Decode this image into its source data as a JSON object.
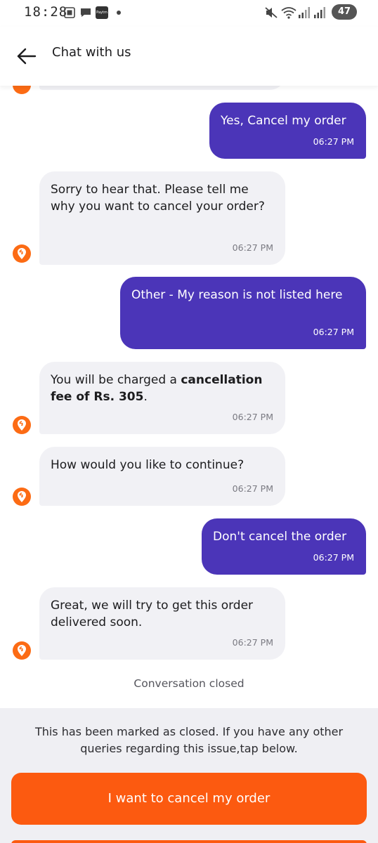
{
  "status_bar": {
    "time": "18:28",
    "paytm_label": "Paytm",
    "battery": "47"
  },
  "header": {
    "title": "Chat with us"
  },
  "messages": [
    {
      "from": "user",
      "text": "Yes, Cancel my order",
      "time": "06:27 PM"
    },
    {
      "from": "bot",
      "text": "Sorry to hear that. Please tell me why you want to cancel your order?",
      "time": "06:27 PM"
    },
    {
      "from": "user",
      "text": "Other - My reason is not listed here",
      "time": "06:27 PM"
    },
    {
      "from": "bot",
      "text_before": "You will be charged a ",
      "text_bold": "cancellation fee of Rs. 305",
      "text_after": ".",
      "time": "06:27 PM"
    },
    {
      "from": "bot",
      "text": "How would you like to continue?",
      "time": "06:27 PM"
    },
    {
      "from": "user",
      "text": "Don't cancel the order",
      "time": "06:27 PM"
    },
    {
      "from": "bot",
      "text": "Great, we will try to get this order delivered soon.",
      "time": "06:27 PM"
    }
  ],
  "conversation_status": "Conversation closed",
  "footer": {
    "note": "This has been marked as closed. If you have any other queries regarding this issue,tap below.",
    "cancel_button": "I want to cancel my order"
  },
  "colors": {
    "user_bubble": "#4b35b8",
    "bot_bubble": "#f1f1f5",
    "accent": "#fc5a10"
  }
}
